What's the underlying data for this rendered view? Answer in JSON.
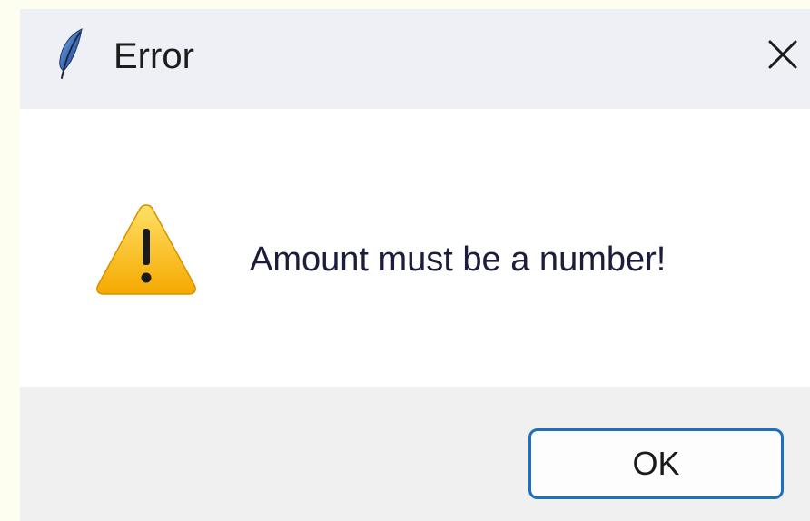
{
  "dialog": {
    "title": "Error",
    "app_icon": "feather-icon",
    "close_icon": "close-icon",
    "message_icon": "warning-icon",
    "message": "Amount must be a number!",
    "ok_label": "OK"
  },
  "colors": {
    "titlebar_bg": "#eef0f6",
    "footer_bg": "#f0f0f0",
    "ok_border": "#1f6fbf",
    "warning_yellow": "#fbc02d",
    "page_bg": "#fefef0"
  }
}
